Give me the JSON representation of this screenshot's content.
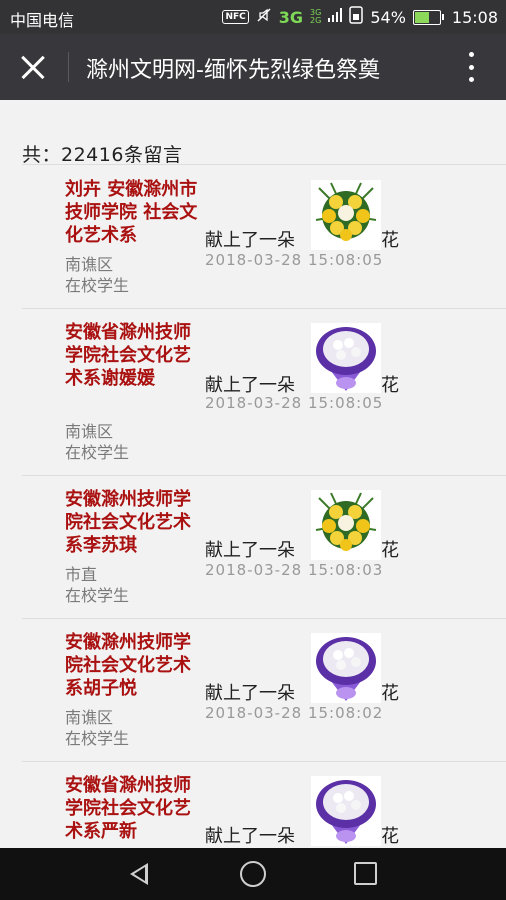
{
  "status_bar": {
    "carrier": "中国电信",
    "nfc": "NFC",
    "network": "3G",
    "network_small": "3G",
    "battery_percent": "54%",
    "battery_level": 0.54,
    "time": "15:08"
  },
  "header": {
    "title": "滁州文明网-缅怀先烈绿色祭奠"
  },
  "total_label": "共：22416条留言",
  "entries": [
    {
      "name": "刘卉 安徽滁州市技师学院 社会文化艺术系",
      "region": "南谯区",
      "role": "在校学生",
      "offer": "献上了一朵",
      "flower": "yellow-chrysanthemum",
      "hua": "花",
      "time": "2018-03-28 15:08:05"
    },
    {
      "name": "安徽省滁州技师学院社会文化艺术系谢媛媛",
      "region": "南谯区",
      "role": "在校学生",
      "offer": "献上了一朵",
      "flower": "white-purple-bouquet",
      "hua": "花",
      "time": "2018-03-28 15:08:05"
    },
    {
      "name": "安徽滁州技师学院社会文化艺术系李苏琪",
      "region": "市直",
      "role": "在校学生",
      "offer": "献上了一朵",
      "flower": "yellow-chrysanthemum",
      "hua": "花",
      "time": "2018-03-28 15:08:03"
    },
    {
      "name": "安徽滁州技师学院社会文化艺术系胡子悦",
      "region": "南谯区",
      "role": "在校学生",
      "offer": "献上了一朵",
      "flower": "white-purple-bouquet",
      "hua": "花",
      "time": "2018-03-28 15:08:02"
    },
    {
      "name": "安徽省滁州技师学院社会文化艺术系严新",
      "region": "",
      "role": "",
      "offer": "献上了一朵",
      "flower": "white-purple-bouquet",
      "hua": "花",
      "time": ""
    }
  ],
  "colors": {
    "name_red": "#aa1111",
    "title_bar": "#38383c",
    "status_bar": "#333335",
    "background": "#f2f2f2"
  }
}
